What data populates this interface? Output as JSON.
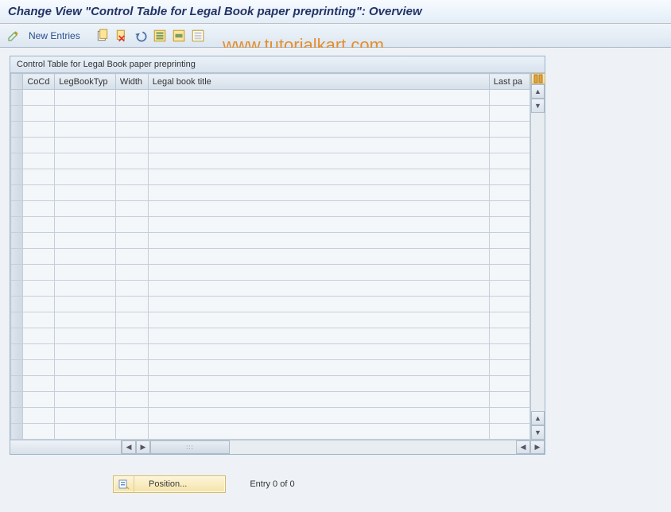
{
  "title": "Change View \"Control Table for Legal Book paper preprinting\": Overview",
  "toolbar": {
    "new_entries_label": "New Entries",
    "icons": [
      "change-icon",
      "copy-icon",
      "delete-icon",
      "undo-icon",
      "select-all-icon",
      "select-block-icon",
      "deselect-all-icon"
    ]
  },
  "grid": {
    "title": "Control Table for Legal Book paper preprinting",
    "columns": [
      "CoCd",
      "LegBookTyp",
      "Width",
      "Legal book title",
      "Last pa"
    ],
    "rows": 22
  },
  "footer": {
    "position_label": "Position...",
    "entry_label": "Entry 0 of 0"
  },
  "watermark": "www.tutorialkart.com"
}
